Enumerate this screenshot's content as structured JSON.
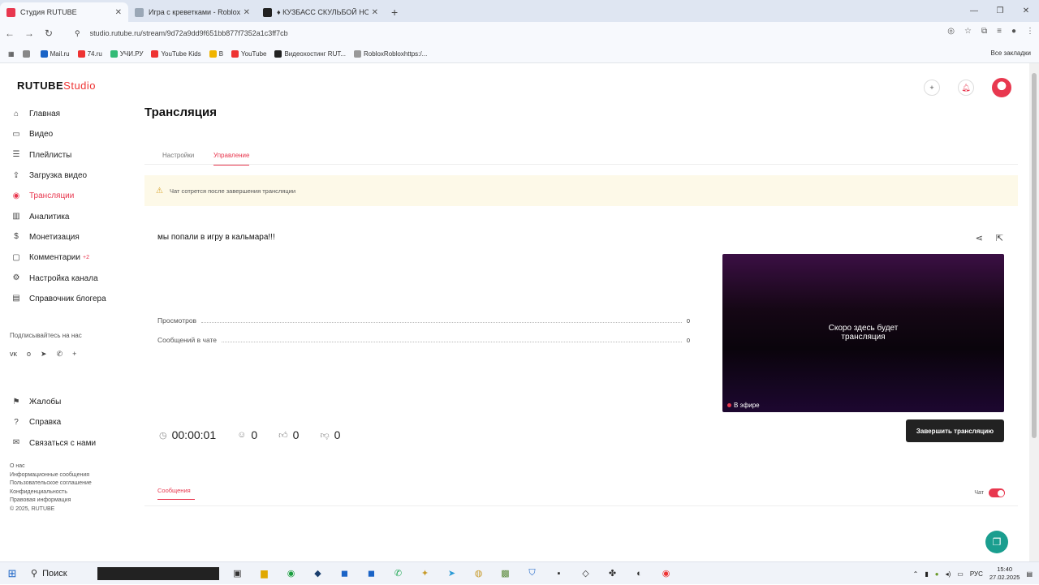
{
  "browser": {
    "tabs": [
      {
        "title": "Студия RUTUBE",
        "active": true,
        "fav_color": "#e8384f"
      },
      {
        "title": "Игра с креветками - Roblox",
        "active": false,
        "fav_color": "#9aa7b6"
      },
      {
        "title": "♦ КУЗБАСС СКУЛЬБОЙ НОВАЯ",
        "active": false,
        "fav_color": "#222"
      }
    ],
    "new_tab": "+",
    "url": "studio.rutube.ru/stream/9d72a9dd9f651bb877f7352a1c3ff7cb",
    "bookmarks": [
      {
        "label": "",
        "color": "#888"
      },
      {
        "label": "Mail.ru",
        "color": "#1a63c6"
      },
      {
        "label": "74.ru",
        "color": "#e33"
      },
      {
        "label": "УЧИ.РУ",
        "color": "#3b7"
      },
      {
        "label": "YouTube Kids",
        "color": "#e33"
      },
      {
        "label": "В",
        "color": "#f0b400"
      },
      {
        "label": "YouTube",
        "color": "#e33"
      },
      {
        "label": "Видеохостинг RUT...",
        "color": "#222"
      },
      {
        "label": "RobloxRobloxhttps:/...",
        "color": "#999"
      }
    ],
    "all_bookmarks": "Все закладки"
  },
  "sidebar": {
    "logo": "RUTUBE",
    "logo_suffix": "Studio",
    "items": [
      {
        "label": "Главная",
        "icon": "home-icon",
        "glyph": "⌂"
      },
      {
        "label": "Видео",
        "icon": "video-icon",
        "glyph": "▭"
      },
      {
        "label": "Плейлисты",
        "icon": "playlist-icon",
        "glyph": "☰"
      },
      {
        "label": "Загрузка видео",
        "icon": "upload-icon",
        "glyph": "⇪"
      },
      {
        "label": "Трансляции",
        "icon": "broadcast-icon",
        "glyph": "◉",
        "active": true
      },
      {
        "label": "Аналитика",
        "icon": "analytics-icon",
        "glyph": "▥"
      },
      {
        "label": "Монетизация",
        "icon": "money-icon",
        "glyph": "$"
      },
      {
        "label": "Комментарии",
        "icon": "comments-icon",
        "glyph": "▢",
        "badge": "+2"
      },
      {
        "label": "Настройка канала",
        "icon": "gear-icon",
        "glyph": "⚙"
      },
      {
        "label": "Справочник блогера",
        "icon": "book-icon",
        "glyph": "▤"
      }
    ],
    "subscribe_label": "Подписывайтесь на нас",
    "socials": [
      "vk-icon",
      "ok-icon",
      "telegram-icon",
      "viber-icon",
      "plus-icon"
    ],
    "socials_glyphs": [
      "ᴠᴋ",
      "ᴏ",
      "➤",
      "✆",
      "+"
    ],
    "items2": [
      {
        "label": "Жалобы",
        "icon": "flag-icon",
        "glyph": "⚑"
      },
      {
        "label": "Справка",
        "icon": "help-icon",
        "glyph": "?"
      },
      {
        "label": "Связаться с нами",
        "icon": "mail-icon",
        "glyph": "✉"
      }
    ],
    "footer": [
      "О нас",
      "Информационные сообщения",
      "Пользовательское соглашение",
      "Конфиденциальность",
      "Правовая информация",
      "© 2025, RUTUBE"
    ]
  },
  "main": {
    "title": "Трансляция",
    "tabs": [
      {
        "label": "Настройки",
        "active": false
      },
      {
        "label": "Управление",
        "active": true
      }
    ],
    "warning": "Чат сотрется после завершения трансляции",
    "stream_title": "мы попали в игру в кальмара!!!",
    "stats": [
      {
        "label": "Просмотров",
        "value": "0"
      },
      {
        "label": "Сообщений в чате",
        "value": "0"
      }
    ],
    "timer": "00:00:01",
    "viewers": "0",
    "likes": "0",
    "dislikes": "0",
    "player_message_line1": "Скоро здесь будет",
    "player_message_line2": "трансляция",
    "live_label": "В эфире",
    "end_button": "Завершить трансляцию",
    "messages_tab": "Сообщения",
    "chat_label": "Чат",
    "chat_enabled": true
  },
  "taskbar": {
    "search": "Поиск",
    "lang": "РУС",
    "time": "15:40",
    "date": "27.02.2025"
  },
  "colors": {
    "accent": "#e8384f",
    "warning_bg": "#fdf9e8",
    "help_fab": "#1a9e8f"
  }
}
